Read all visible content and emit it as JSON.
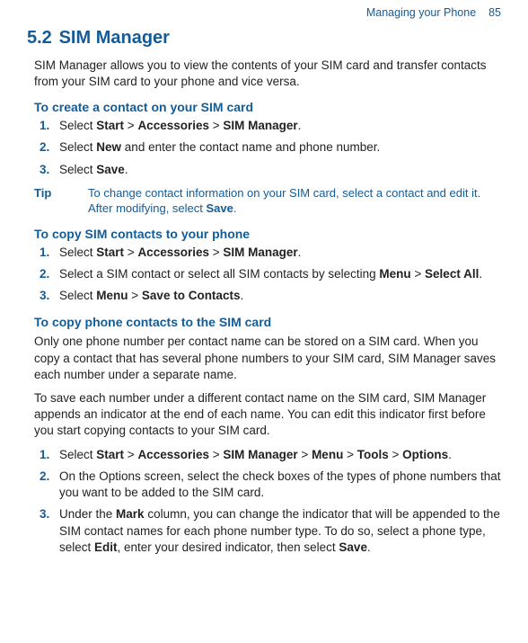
{
  "header": {
    "section": "Managing your Phone",
    "page": "85"
  },
  "h1": {
    "num": "5.2",
    "title": "SIM Manager"
  },
  "intro": "SIM Manager allows you to view the contents of your SIM card and transfer contacts from your SIM card to your phone and vice versa.",
  "sectA": {
    "heading": "To create a contact on your SIM card",
    "s1_a": "Select ",
    "s1_b": "Start",
    "s1_c": " > ",
    "s1_d": "Accessories",
    "s1_e": " > ",
    "s1_f": "SIM Manager",
    "s1_g": ".",
    "s2_a": "Select ",
    "s2_b": "New",
    "s2_c": " and enter the contact name and phone number.",
    "s3_a": "Select ",
    "s3_b": "Save",
    "s3_c": "."
  },
  "tip": {
    "label": "Tip",
    "body_a": "To change contact information on your SIM card, select a contact and edit it. After modifying, select ",
    "body_b": "Save",
    "body_c": "."
  },
  "sectB": {
    "heading": "To copy SIM contacts to your phone",
    "s1_a": "Select ",
    "s1_b": "Start",
    "s1_c": " > ",
    "s1_d": "Accessories",
    "s1_e": " > ",
    "s1_f": "SIM Manager",
    "s1_g": ".",
    "s2_a": "Select a SIM contact or select all SIM contacts by selecting ",
    "s2_b": "Menu",
    "s2_c": " > ",
    "s2_d": "Select All",
    "s2_e": ".",
    "s3_a": "Select ",
    "s3_b": "Menu",
    "s3_c": " > ",
    "s3_d": "Save to Contacts",
    "s3_e": "."
  },
  "sectC": {
    "heading": "To copy phone contacts to the SIM card",
    "p1": "Only one phone number per contact name can be stored on a SIM card. When you copy a contact that has several phone numbers to your SIM card, SIM Manager saves each number under a separate name.",
    "p2": "To save each number under a different contact name on the SIM card, SIM Manager appends an indicator at the end of each name. You can edit this indicator first before you start copying contacts to your SIM card.",
    "s1_a": "Select ",
    "s1_b": "Start",
    "s1_c": " > ",
    "s1_d": "Accessories",
    "s1_e": " > ",
    "s1_f": "SIM Manager",
    "s1_g": " > ",
    "s1_h": "Menu",
    "s1_i": " > ",
    "s1_j": "Tools",
    "s1_k": " > ",
    "s1_l": "Options",
    "s1_m": ".",
    "s2": "On the Options screen, select the check boxes of the types of phone numbers that you want to be added to the SIM card.",
    "s3_a": "Under the ",
    "s3_b": "Mark",
    "s3_c": " column, you can change the indicator that will be appended to the SIM contact names for each phone number type. To do so, select a phone type, select ",
    "s3_d": "Edit",
    "s3_e": ", enter your desired indicator, then select ",
    "s3_f": "Save",
    "s3_g": "."
  },
  "nums": {
    "n1": "1.",
    "n2": "2.",
    "n3": "3."
  }
}
